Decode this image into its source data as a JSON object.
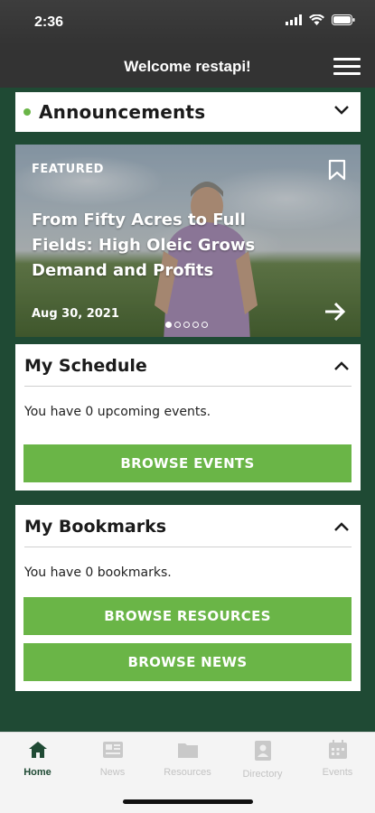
{
  "status": {
    "time": "2:36"
  },
  "header": {
    "title": "Welcome restapi!"
  },
  "announcements": {
    "label": "Announcements"
  },
  "featured": {
    "tag": "FEATURED",
    "title": "From Fifty Acres to Full Fields: High Oleic Grows Demand and Profits",
    "date": "Aug 30, 2021",
    "pages": 5,
    "active_page": 1
  },
  "schedule": {
    "title": "My Schedule",
    "text": "You have 0 upcoming events.",
    "button": "BROWSE EVENTS"
  },
  "bookmarks": {
    "title": "My Bookmarks",
    "text": "You have 0 bookmarks.",
    "button_resources": "BROWSE RESOURCES",
    "button_news": "BROWSE NEWS"
  },
  "tabs": [
    {
      "label": "Home",
      "icon": "home-icon"
    },
    {
      "label": "News",
      "icon": "news-icon"
    },
    {
      "label": "Resources",
      "icon": "resources-icon"
    },
    {
      "label": "Directory",
      "icon": "directory-icon"
    },
    {
      "label": "Events",
      "icon": "calendar-icon"
    }
  ],
  "colors": {
    "brand_green": "#1f4a34",
    "accent_green": "#6ab547",
    "header": "#333333"
  }
}
